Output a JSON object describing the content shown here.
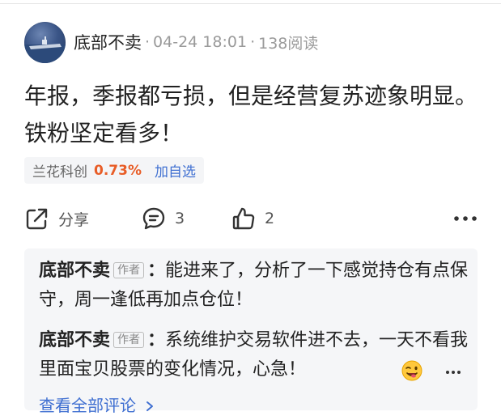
{
  "post": {
    "author": "底部不卖",
    "date": "04-24 18:01",
    "views": "138阅读",
    "text": "年报，季报都亏损，但是经营复苏迹象明显。铁粉坚定看多！"
  },
  "stock_tag": {
    "name": "兰花科创",
    "change": "0.73%",
    "add_label": "加自选"
  },
  "actions": {
    "share_label": "分享",
    "comment_count": "3",
    "like_count": "2"
  },
  "comments": [
    {
      "author": "底部不卖",
      "badge": "作者",
      "separator": "：",
      "text": "能进来了，分析了一下感觉持仓有点保守，周一逢低再加点仓位！"
    },
    {
      "author": "底部不卖",
      "badge": "作者",
      "separator": "：",
      "text": "系统维护交易软件进不去，一天不看我里面宝贝股票的变化情况，心急！"
    }
  ],
  "view_all_label": "查看全部评论",
  "icons": {
    "share": "share-icon",
    "comment": "comment-icon",
    "like": "thumbs-up-icon",
    "more": "more-icon",
    "emoji": "winking-face-emoji"
  },
  "colors": {
    "stock_change": "#e85d27",
    "link": "#3f6fd1"
  }
}
